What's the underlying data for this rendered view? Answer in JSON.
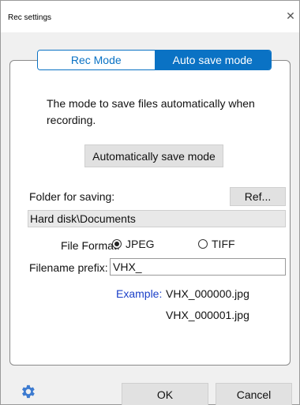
{
  "window": {
    "title": "Rec settings",
    "close_glyph": "✕"
  },
  "tabs": [
    {
      "label": "Rec Mode",
      "active": false
    },
    {
      "label": "Auto save mode",
      "active": true
    }
  ],
  "description": "The mode to save files automatically when recording.",
  "mode_button": {
    "label": "Automatically save mode"
  },
  "folder": {
    "label": "Folder for saving:",
    "ref_label": "Ref...",
    "value": "Hard disk\\Documents"
  },
  "file_format": {
    "label": "File Format:",
    "options": [
      {
        "label": "JPEG",
        "selected": true
      },
      {
        "label": "TIFF",
        "selected": false
      }
    ]
  },
  "prefix": {
    "label": "Filename prefix:",
    "value": "VHX_"
  },
  "example": {
    "label": "Example:",
    "files": [
      "VHX_000000.jpg",
      "VHX_000001.jpg"
    ]
  },
  "footer": {
    "ok_label": "OK",
    "cancel_label": "Cancel",
    "settings_icon": "gear-icon"
  },
  "colors": {
    "accent": "#0a72c4",
    "example": "#1a3fc8",
    "gear": "#3d7bd0"
  }
}
